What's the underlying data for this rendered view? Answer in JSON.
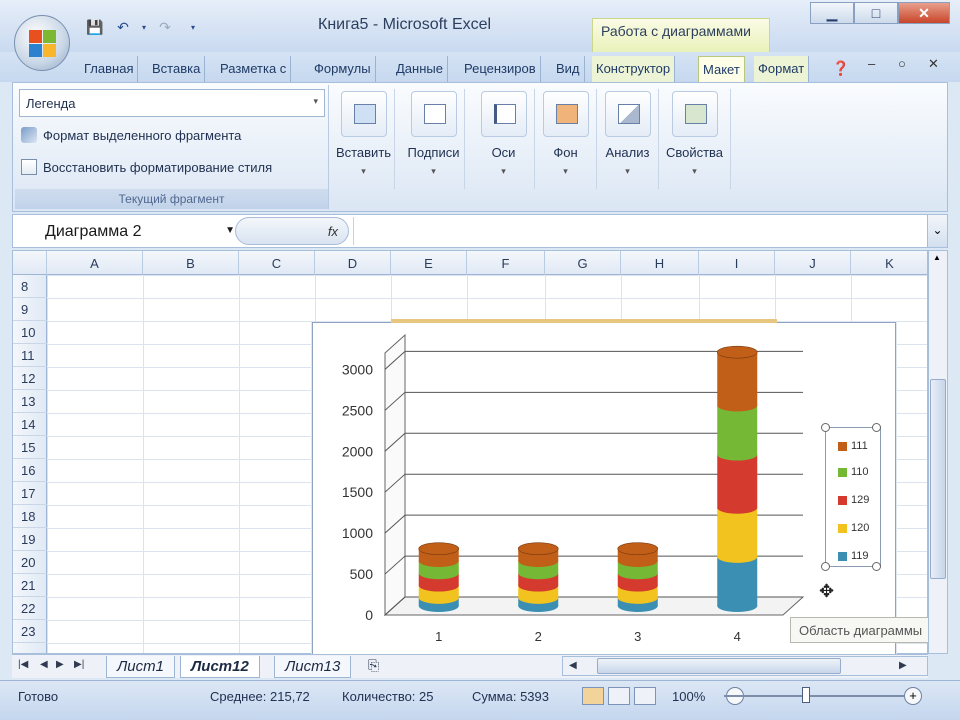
{
  "titlebar": {
    "title": "Книга5 - Microsoft Excel",
    "context_title": "Работа с диаграммами"
  },
  "tabs": [
    {
      "label": "Главная"
    },
    {
      "label": "Вставка"
    },
    {
      "label": "Разметка с"
    },
    {
      "label": "Формулы"
    },
    {
      "label": "Данные"
    },
    {
      "label": "Рецензиров"
    },
    {
      "label": "Вид"
    },
    {
      "label": "Конструктор"
    },
    {
      "label": "Макет"
    },
    {
      "label": "Формат"
    }
  ],
  "ribbon": {
    "current_selection": {
      "combo_value": "Легенда",
      "format_selection": "Формат выделенного фрагмента",
      "reset_style": "Восстановить форматирование стиля",
      "group_label": "Текущий фрагмент"
    },
    "buttons": [
      {
        "label": "Вставить"
      },
      {
        "label": "Подписи"
      },
      {
        "label": "Оси"
      },
      {
        "label": "Фон"
      },
      {
        "label": "Анализ"
      },
      {
        "label": "Свойства"
      }
    ]
  },
  "formula_bar": {
    "name_box": "Диаграмма 2",
    "fx": "fx"
  },
  "sheet": {
    "columns": [
      "A",
      "B",
      "C",
      "D",
      "E",
      "F",
      "G",
      "H",
      "I",
      "J",
      "K"
    ],
    "rows": [
      "8",
      "9",
      "10",
      "11",
      "12",
      "13",
      "14",
      "15",
      "16",
      "17",
      "18",
      "19",
      "20",
      "21",
      "22",
      "23"
    ]
  },
  "chart_data": {
    "type": "bar",
    "categories": [
      "1",
      "2",
      "3",
      "4"
    ],
    "series": [
      {
        "name": "119",
        "values": [
          100,
          100,
          100,
          600
        ],
        "color": "#3a8fb3"
      },
      {
        "name": "120",
        "values": [
          150,
          150,
          150,
          600
        ],
        "color": "#f2c31e"
      },
      {
        "name": "129",
        "values": [
          150,
          150,
          150,
          650
        ],
        "color": "#d53a2e"
      },
      {
        "name": "110",
        "values": [
          150,
          150,
          150,
          600
        ],
        "color": "#74b835"
      },
      {
        "name": "111",
        "values": [
          150,
          150,
          150,
          650
        ],
        "color": "#c15e18"
      }
    ],
    "yticks": [
      "0",
      "500",
      "1000",
      "1500",
      "2000",
      "2500",
      "3000"
    ],
    "ylim": [
      0,
      3200
    ],
    "grid": true,
    "legend": "right"
  },
  "tooltip": "Область диаграммы",
  "sheet_tabs": [
    {
      "label": "Лист1"
    },
    {
      "label": "Лист12"
    },
    {
      "label": "Лист13"
    }
  ],
  "status": {
    "ready": "Готово",
    "average": "Среднее: 215,72",
    "count": "Количество: 25",
    "sum": "Сумма: 5393",
    "zoom": "100%"
  }
}
